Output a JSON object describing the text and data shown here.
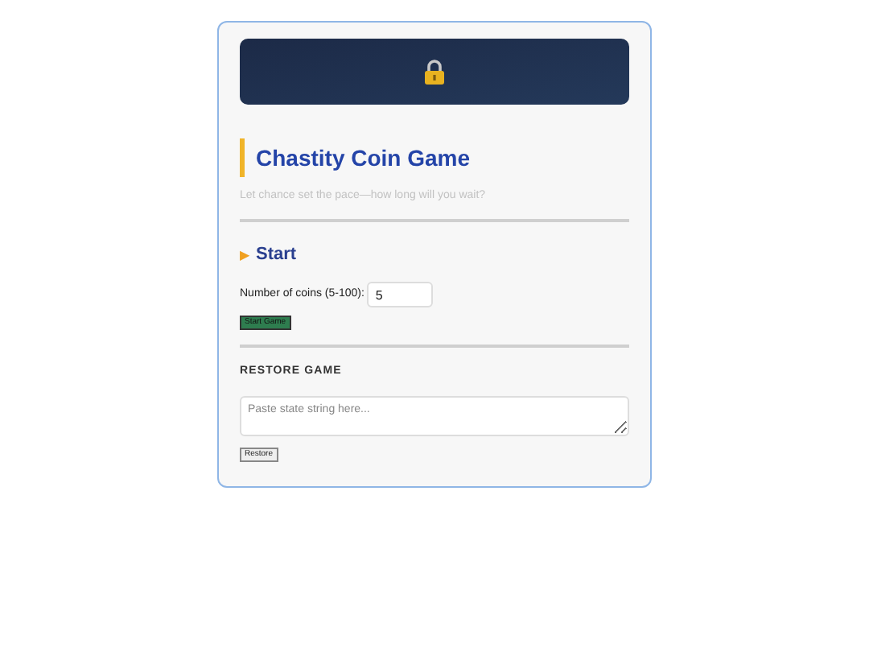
{
  "title": "Chastity Coin Game",
  "subtitle": "Let chance set the pace—how long will you wait?",
  "start": {
    "marker": "▶",
    "heading": "Start",
    "coins_label": "Number of coins (5-100):",
    "coins_value": "5",
    "button": "Start Game"
  },
  "restore": {
    "heading": "RESTORE GAME",
    "placeholder": "Paste state string here...",
    "button": "Restore"
  }
}
